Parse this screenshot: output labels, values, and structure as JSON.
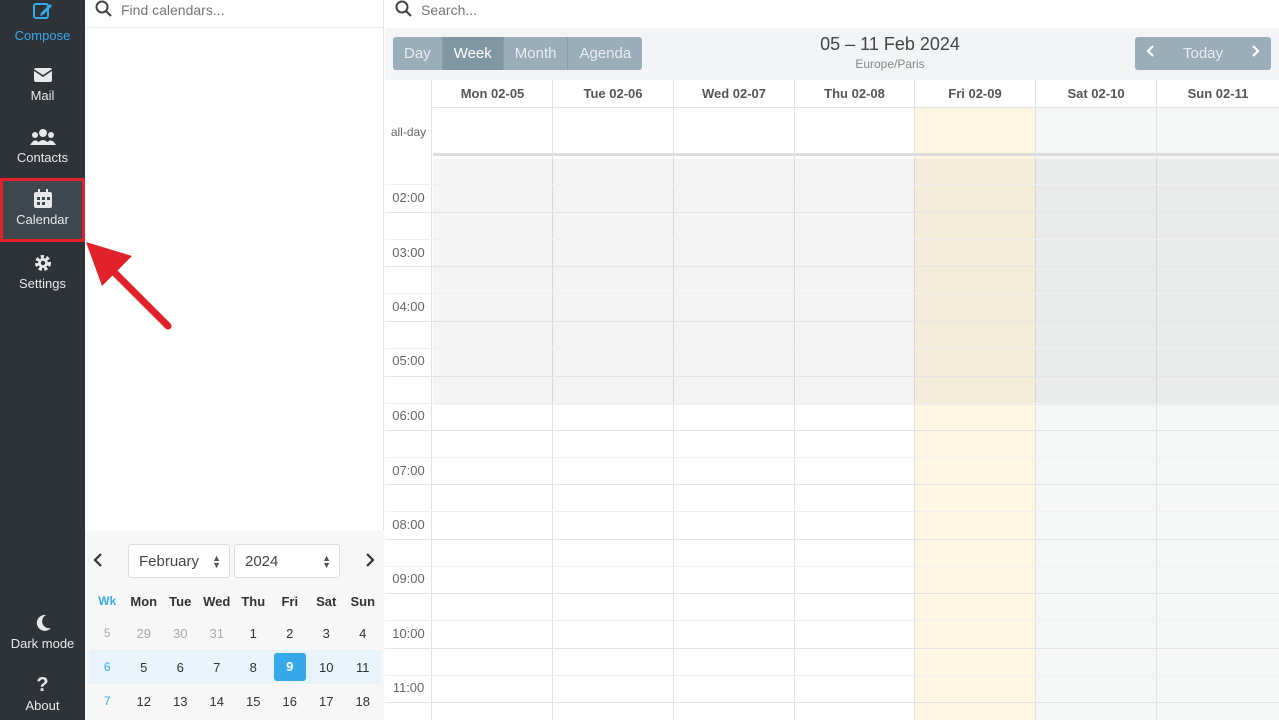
{
  "nav": {
    "compose": "Compose",
    "mail": "Mail",
    "contacts": "Contacts",
    "calendar": "Calendar",
    "settings": "Settings",
    "dark_mode": "Dark mode",
    "about": "About"
  },
  "calendar_list": {
    "search_placeholder": "Find calendars..."
  },
  "mini_calendar": {
    "month": "February",
    "year": "2024",
    "headers": [
      "Wk",
      "Mon",
      "Tue",
      "Wed",
      "Thu",
      "Fri",
      "Sat",
      "Sun"
    ],
    "weeks": [
      {
        "wk": "5",
        "days": [
          "29",
          "30",
          "31",
          "1",
          "2",
          "3",
          "4"
        ]
      },
      {
        "wk": "6",
        "days": [
          "5",
          "6",
          "7",
          "8",
          "9",
          "10",
          "11"
        ]
      },
      {
        "wk": "7",
        "days": [
          "12",
          "13",
          "14",
          "15",
          "16",
          "17",
          "18"
        ]
      }
    ],
    "selected_day": "9"
  },
  "main": {
    "search_placeholder": "Search...",
    "views": [
      "Day",
      "Week",
      "Month",
      "Agenda"
    ],
    "active_view": "Week",
    "title": "05 – 11 Feb 2024",
    "timezone": "Europe/Paris",
    "today_label": "Today",
    "all_day_label": "all-day",
    "days": [
      "Mon 02-05",
      "Tue 02-06",
      "Wed 02-07",
      "Thu 02-08",
      "Fri 02-09",
      "Sat 02-10",
      "Sun 02-11"
    ],
    "hours": [
      "02:00",
      "03:00",
      "04:00",
      "05:00",
      "06:00",
      "07:00",
      "08:00",
      "09:00",
      "10:00",
      "11:00"
    ]
  },
  "colors": {
    "accent": "#37a8ea",
    "sidebar": "#2e3338",
    "highlight_border": "#e2222a",
    "today_column": "#fdf7e2"
  }
}
